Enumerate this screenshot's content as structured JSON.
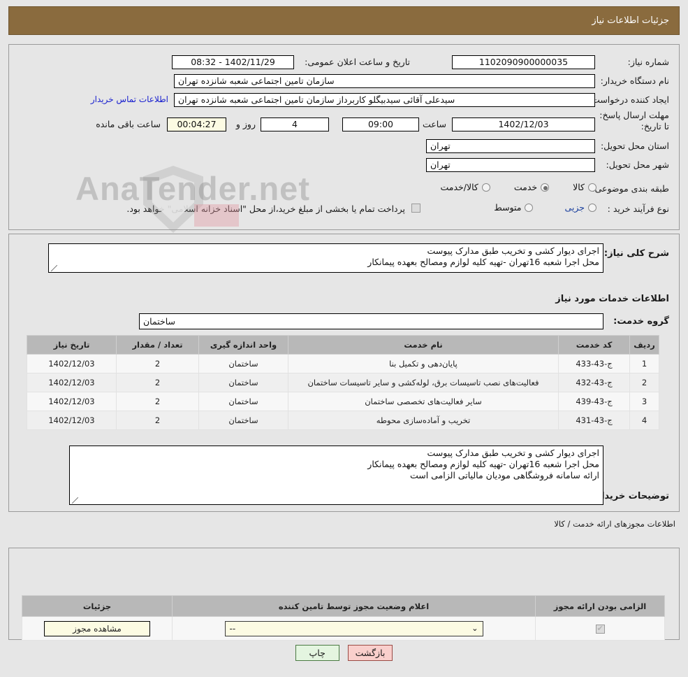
{
  "header": {
    "title": "جزئیات اطلاعات نیاز"
  },
  "top": {
    "need_number_label": "شماره نیاز:",
    "need_number_value": "1102090900000035",
    "announce_label": "تاریخ و ساعت اعلان عمومی:",
    "announce_value": "1402/11/29 - 08:32",
    "buyer_org_label": "نام دستگاه خریدار:",
    "buyer_org_value": "سازمان تامین اجتماعی شعبه شانزده تهران",
    "creator_label": "ایجاد کننده درخواست:",
    "creator_value": "سیدعلی آقائی سیدبیگلو کاربرداز سازمان تامین اجتماعی شعبه شانزده تهران",
    "contact_link": "اطلاعات تماس خریدار",
    "deadline_label": "مهلت ارسال پاسخ: تا تاریخ:",
    "deadline_date": "1402/12/03",
    "hour_label": "ساعت",
    "deadline_time": "09:00",
    "days_value": "4",
    "days_label": "روز و",
    "countdown_value": "00:04:27",
    "remaining_label": "ساعت باقی مانده",
    "province_label": "استان محل تحویل:",
    "province_value": "تهران",
    "city_label": "شهر محل تحویل:",
    "city_value": "تهران",
    "category_label": "طبقه بندی موضوعی:",
    "category_options": [
      {
        "label": "کالا",
        "selected": false
      },
      {
        "label": "خدمت",
        "selected": true
      },
      {
        "label": "کالا/خدمت",
        "selected": false
      }
    ],
    "process_label": "نوع فرآیند خرید :",
    "process_options": [
      {
        "label": "جزیی",
        "selected": false
      },
      {
        "label": "متوسط",
        "selected": false
      }
    ],
    "treasury_checkbox_checked": false,
    "treasury_text": "پرداخت تمام یا بخشی از مبلغ خرید،از محل \"اسناد خزانه اسلامی\" خواهد بود."
  },
  "mid": {
    "general_desc_label": "شرح کلی نیاز:",
    "general_desc_value": "اجرای دیوار کشی و تخریب طبق  مدارک پیوست\nمحل اجرا شعبه 16تهران -تهیه کلیه لوازم ومصالح بعهده پیمانکار",
    "services_info_title": "اطلاعات خدمات مورد نیاز",
    "service_group_label": "گروه خدمت:",
    "service_group_value": "ساختمان",
    "buyer_notes_label": "توضیحات خریدار:",
    "buyer_notes_value": "اجرای دیوار کشی و تخریب طبق  مدارک پیوست\nمحل اجرا شعبه 16تهران -تهیه کلیه لوازم ومصالح بعهده پیمانکار\nارائه سامانه فروشگاهی مودیان مالیاتی الزامی است"
  },
  "service_table": {
    "columns": [
      "ردیف",
      "کد خدمت",
      "نام خدمت",
      "واحد اندازه گیری",
      "تعداد / مقدار",
      "تاریخ نیاز"
    ],
    "rows": [
      {
        "row": "1",
        "code": "ج-43-433",
        "name": "پایان‌دهی و تکمیل بنا",
        "unit": "ساختمان",
        "qty": "2",
        "date": "1402/12/03"
      },
      {
        "row": "2",
        "code": "ج-43-432",
        "name": "فعالیت‌های نصب تاسیسات برق، لوله‌کشی و سایر تاسیسات ساختمان",
        "unit": "ساختمان",
        "qty": "2",
        "date": "1402/12/03"
      },
      {
        "row": "3",
        "code": "ج-43-439",
        "name": "سایر فعالیت‌های تخصصی ساختمان",
        "unit": "ساختمان",
        "qty": "2",
        "date": "1402/12/03"
      },
      {
        "row": "4",
        "code": "ج-43-431",
        "name": "تخریب و آماده‌سازی محوطه",
        "unit": "ساختمان",
        "qty": "2",
        "date": "1402/12/03"
      }
    ]
  },
  "permits": {
    "section_label": "اطلاعات مجوزهای ارائه خدمت / کالا",
    "columns": [
      "الزامی بودن ارائه مجوز",
      "اعلام وضعیت مجوز توسط تامین کننده",
      "جزئیات"
    ],
    "rows": [
      {
        "required_checked": true,
        "status_value": "--",
        "details_button": "مشاهده مجوز"
      }
    ]
  },
  "footer": {
    "print_label": "چاپ",
    "back_label": "بازگشت"
  },
  "watermark": {
    "text": "AnaTender.net"
  }
}
